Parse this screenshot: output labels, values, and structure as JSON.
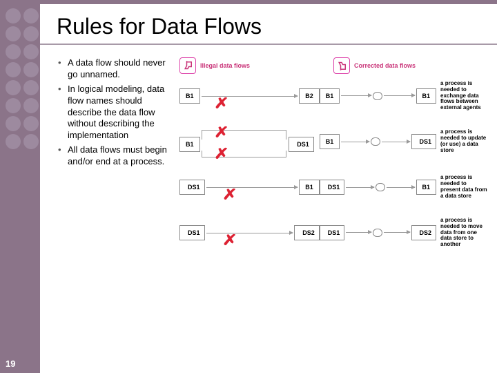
{
  "title": "Rules for Data Flows",
  "bullets": [
    "A data flow should never go unnamed.",
    "In logical modeling, data flow names should describe the data flow without describing the implementation",
    "All data flows must begin and/or end at a process."
  ],
  "headers": {
    "illegal": "Illegal data flows",
    "corrected": "Corrected data flows"
  },
  "labels": {
    "B1": "B1",
    "B2": "B2",
    "DS1": "DS1",
    "DS2": "DS2",
    "P": " "
  },
  "captions": [
    "a process is needed to exchange data flows between external agents",
    "a process is needed to update (or use) a data store",
    "a process is needed to present data from a data store",
    "a process is needed to move data from one data store to another"
  ],
  "slideNumber": "19"
}
